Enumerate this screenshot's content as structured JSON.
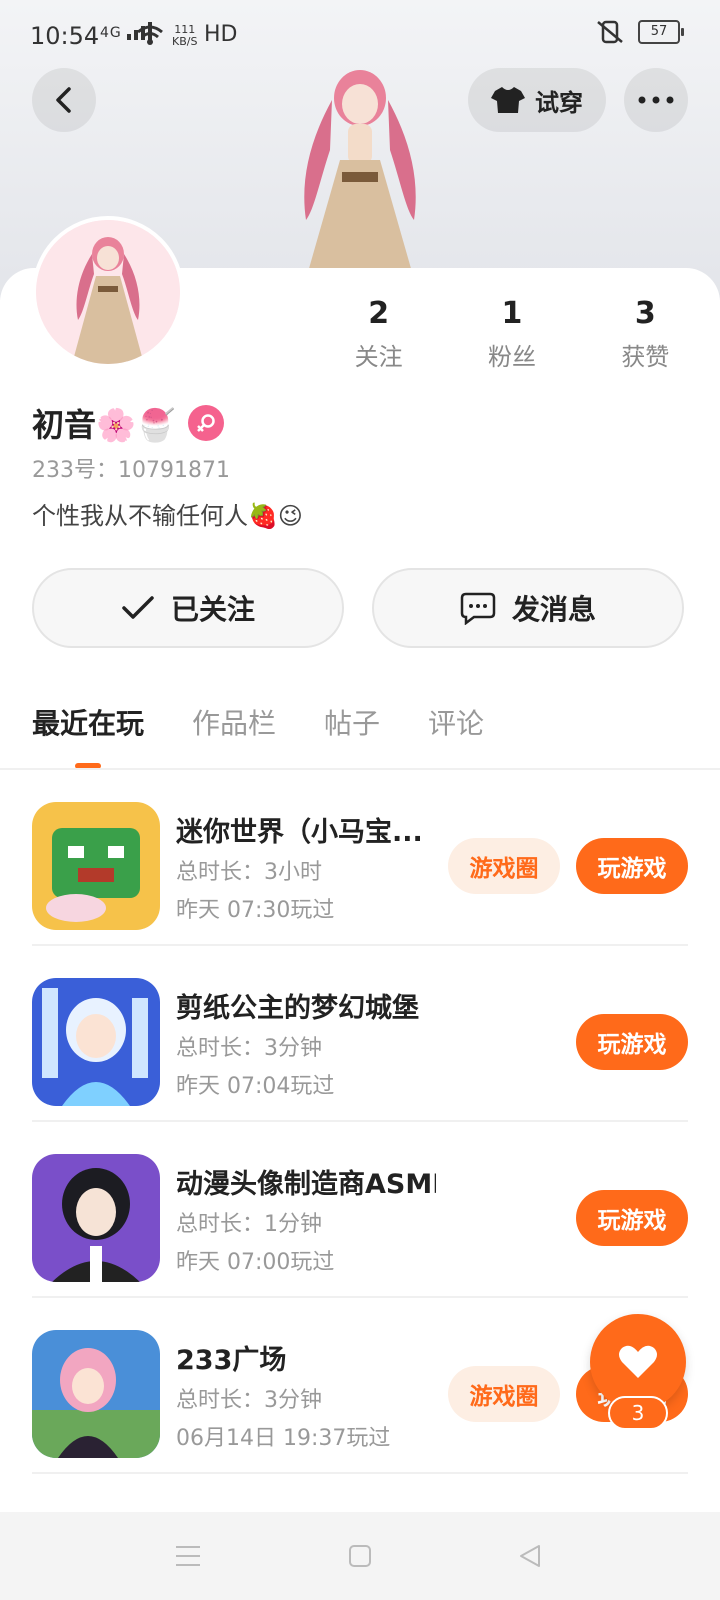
{
  "status_bar": {
    "time": "10:54",
    "network": "4G",
    "speed_top": "111",
    "speed_bottom": "KB/S",
    "hd": "HD",
    "battery": "57"
  },
  "header": {
    "try_on_label": "试穿"
  },
  "profile": {
    "name": "初音🌸🍧",
    "uid": "233号：10791871",
    "bio": "个性我从不输任何人🍓😉",
    "stats": [
      {
        "value": "2",
        "label": "关注"
      },
      {
        "value": "1",
        "label": "粉丝"
      },
      {
        "value": "3",
        "label": "获赞"
      }
    ]
  },
  "actions": {
    "followed_label": "已关注",
    "message_label": "发消息"
  },
  "tabs": [
    "最近在玩",
    "作品栏",
    "帖子",
    "评论"
  ],
  "games": [
    {
      "title": "迷你世界（小马宝...",
      "duration": "总时长：3小时",
      "last_played": "昨天 07:30玩过",
      "circle": "游戏圈",
      "play": "玩游戏",
      "icon_colors": [
        "#3aa04a",
        "#f6c24a"
      ]
    },
    {
      "title": "剪纸公主的梦幻城堡",
      "duration": "总时长：3分钟",
      "last_played": "昨天 07:04玩过",
      "circle": "",
      "play": "玩游戏",
      "icon_colors": [
        "#3a5fd8",
        "#cfe6ff"
      ]
    },
    {
      "title": "动漫头像制造商ASMR",
      "duration": "总时长：1分钟",
      "last_played": "昨天 07:00玩过",
      "circle": "",
      "play": "玩游戏",
      "icon_colors": [
        "#7a4fc9",
        "#d7c0f0"
      ]
    },
    {
      "title": "233广场",
      "duration": "总时长：3分钟",
      "last_played": "06月14日 19:37玩过",
      "circle": "游戏圈",
      "play": "玩游戏",
      "icon_colors": [
        "#4a8fd8",
        "#f2a6c1"
      ]
    }
  ],
  "like_fab": {
    "count": "3"
  },
  "colors": {
    "accent": "#ff6a1a",
    "accent_soft": "#fdeee3",
    "gender_badge": "#f5628e"
  }
}
